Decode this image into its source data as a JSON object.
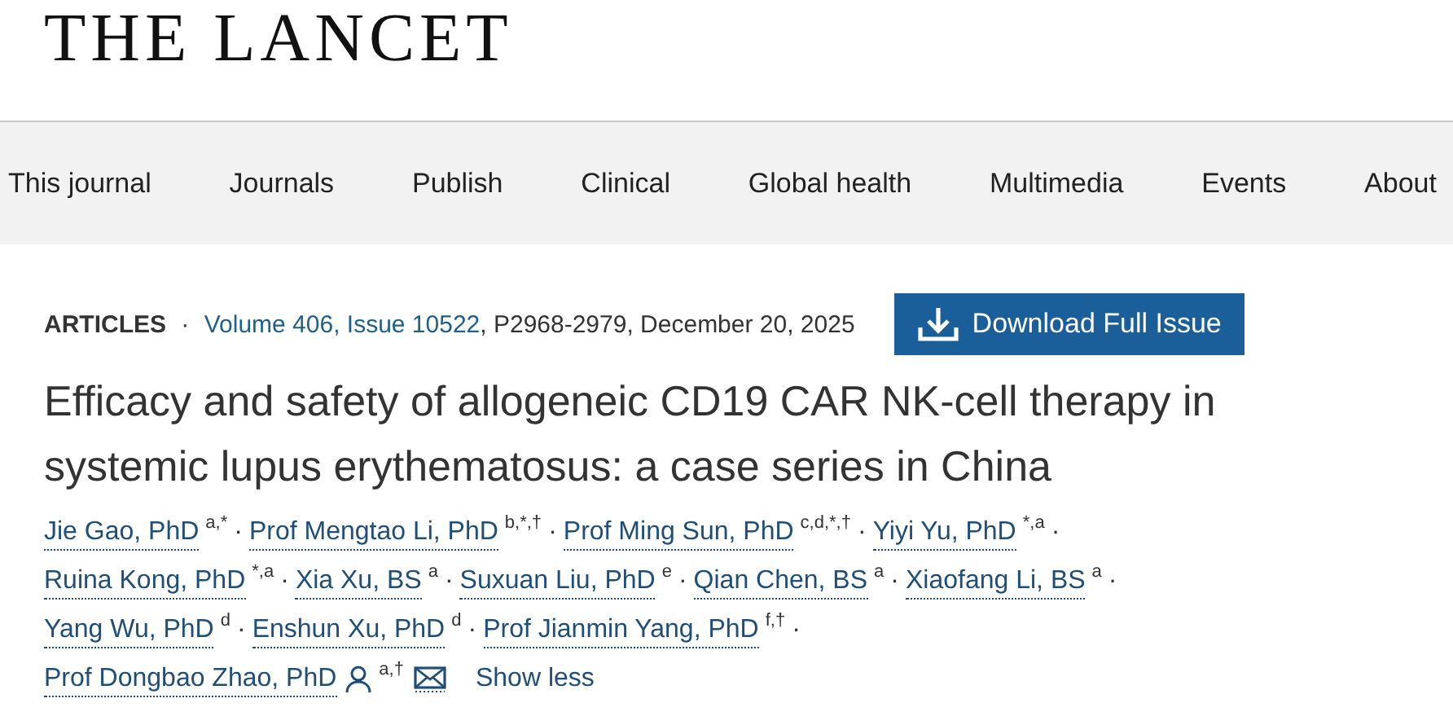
{
  "logo": "THE LANCET",
  "nav": [
    {
      "label": "This journal"
    },
    {
      "label": "Journals"
    },
    {
      "label": "Publish"
    },
    {
      "label": "Clinical"
    },
    {
      "label": "Global health"
    },
    {
      "label": "Multimedia"
    },
    {
      "label": "Events"
    },
    {
      "label": "About"
    }
  ],
  "article": {
    "type": "ARTICLES",
    "separator": "·",
    "volume": "Volume 406, Issue 10522",
    "pages": ", P2968-2979, December 20, 2025",
    "download_button": "Download Full Issue",
    "title": "Efficacy and safety of allogeneic CD19 CAR NK-cell therapy in systemic lupus erythematosus: a case series in China",
    "author_lines": [
      [
        {
          "name": "Jie Gao, PhD",
          "marks": "a,*"
        },
        {
          "name": "Prof Mengtao Li, PhD",
          "marks": "b,*,†"
        },
        {
          "name": "Prof Ming Sun, PhD",
          "marks": "c,d,*,†"
        },
        {
          "name": "Yiyi Yu, PhD",
          "marks": "*,a"
        }
      ],
      [
        {
          "name": "Ruina Kong, PhD",
          "marks": "*,a"
        },
        {
          "name": "Xia Xu, BS",
          "marks": "a"
        },
        {
          "name": "Suxuan Liu, PhD",
          "marks": "e"
        },
        {
          "name": "Qian Chen, BS",
          "marks": "a"
        },
        {
          "name": "Xiaofang Li, BS",
          "marks": "a"
        }
      ],
      [
        {
          "name": "Yang Wu, PhD",
          "marks": "d"
        },
        {
          "name": "Enshun Xu, PhD",
          "marks": "d"
        },
        {
          "name": "Prof Jianmin Yang, PhD",
          "marks": "f,†"
        }
      ],
      [
        {
          "name": "Prof Dongbao Zhao, PhD",
          "marks": "a,†",
          "corresponding": true
        }
      ]
    ],
    "author_separator": "·",
    "show_less": "Show less"
  }
}
